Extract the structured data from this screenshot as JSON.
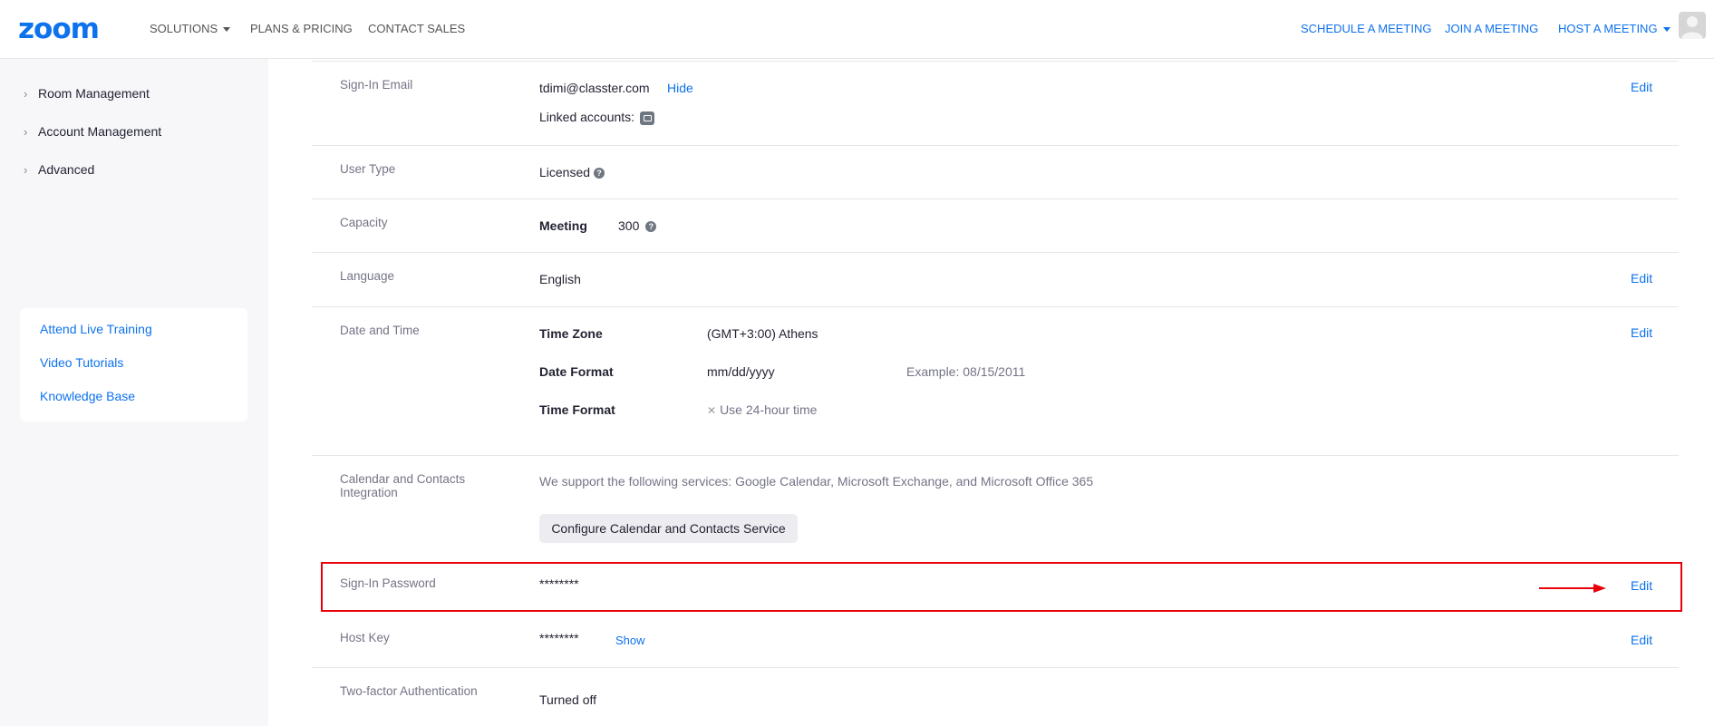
{
  "topbar": {
    "logo": "zoom",
    "nav_left": [
      {
        "label": "SOLUTIONS",
        "has_caret": true
      },
      {
        "label": "PLANS & PRICING"
      },
      {
        "label": "CONTACT SALES"
      }
    ],
    "nav_right": [
      {
        "label": "SCHEDULE A MEETING"
      },
      {
        "label": "JOIN A MEETING"
      },
      {
        "label": "HOST A MEETING",
        "has_caret": true
      }
    ]
  },
  "sidebar": {
    "items": [
      {
        "label": "Room Management"
      },
      {
        "label": "Account Management"
      },
      {
        "label": "Advanced"
      }
    ],
    "help_links": [
      {
        "label": "Attend Live Training"
      },
      {
        "label": "Video Tutorials"
      },
      {
        "label": "Knowledge Base"
      }
    ]
  },
  "profile": {
    "signin_email": {
      "label": "Sign-In Email",
      "value": "tdimi@classter.com",
      "hide": "Hide",
      "linked_label": "Linked accounts:",
      "edit": "Edit"
    },
    "user_type": {
      "label": "User Type",
      "value": "Licensed"
    },
    "capacity": {
      "label": "Capacity",
      "key": "Meeting",
      "value": "300"
    },
    "language": {
      "label": "Language",
      "value": "English",
      "edit": "Edit"
    },
    "date_time": {
      "label": "Date and Time",
      "edit": "Edit",
      "time_zone_label": "Time Zone",
      "time_zone_value": "(GMT+3:00) Athens",
      "date_format_label": "Date Format",
      "date_format_value": "mm/dd/yyyy",
      "example_label": "Example:",
      "example_value": "08/15/2011",
      "time_format_label": "Time Format",
      "time_format_value": "Use 24-hour time"
    },
    "calendar": {
      "label_line1": "Calendar and Contacts",
      "label_line2": "Integration",
      "desc": "We support the following services: Google Calendar, Microsoft Exchange, and Microsoft Office 365",
      "button": "Configure Calendar and Contacts Service"
    },
    "signin_password": {
      "label": "Sign-In Password",
      "value": "********",
      "edit": "Edit"
    },
    "host_key": {
      "label": "Host Key",
      "value": "********",
      "show": "Show",
      "edit": "Edit"
    },
    "two_factor": {
      "label": "Two-factor Authentication",
      "value": "Turned off"
    }
  },
  "colors": {
    "accent": "#0e72ed",
    "highlight": "#e8000b"
  }
}
